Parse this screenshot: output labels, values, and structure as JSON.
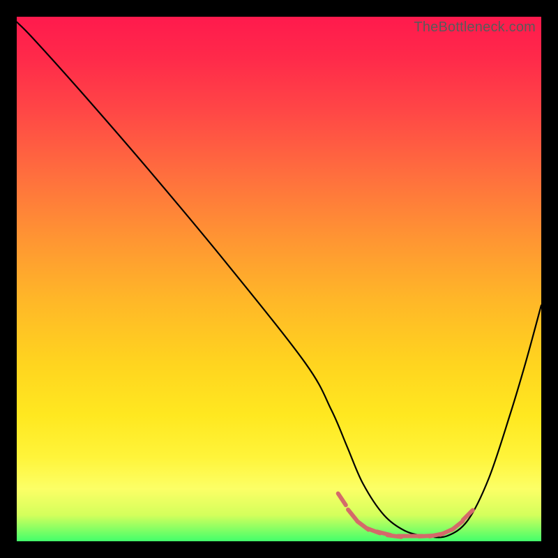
{
  "watermark": "TheBottleneck.com",
  "chart_data": {
    "type": "line",
    "title": "",
    "xlabel": "",
    "ylabel": "",
    "xlim": [
      0,
      100
    ],
    "ylim": [
      0,
      100
    ],
    "background_gradient": {
      "top": "#ff1a4d",
      "bottom": "#42ff6b"
    },
    "series": [
      {
        "name": "bottleneck-curve",
        "color": "#000000",
        "x": [
          0,
          3,
          12,
          25,
          40,
          55,
          60,
          63,
          66,
          70,
          74,
          78,
          82,
          86,
          90,
          94,
          97,
          100
        ],
        "y": [
          99,
          96,
          86,
          71,
          53,
          34,
          25,
          18,
          11,
          5,
          2,
          1,
          1,
          4,
          12,
          24,
          34,
          45
        ]
      }
    ],
    "marker_series": {
      "name": "optimal-zone-marks",
      "color": "#d46a6a",
      "style": "short-strokes",
      "x": [
        62,
        64,
        66,
        68,
        70,
        72,
        74,
        76,
        78,
        80,
        82,
        84,
        86
      ],
      "y": [
        8,
        5,
        3,
        2,
        1.5,
        1,
        1,
        1,
        1,
        1.2,
        1.8,
        3,
        5
      ]
    }
  }
}
